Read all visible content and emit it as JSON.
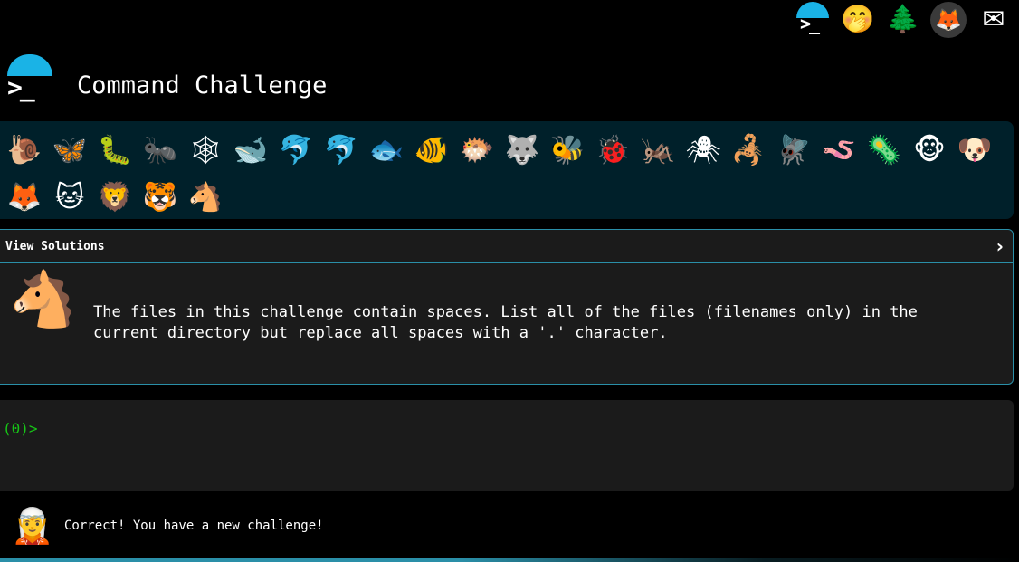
{
  "topbar": {
    "icons": [
      {
        "name": "terminal-logo-icon",
        "glyph": ">_"
      },
      {
        "name": "shushing-face-icon",
        "glyph": "🤭"
      },
      {
        "name": "evergreen-tree-icon",
        "glyph": "🌲"
      },
      {
        "name": "gitlab-icon",
        "glyph": "🦊"
      },
      {
        "name": "envelope-icon",
        "glyph": "✉"
      }
    ]
  },
  "header": {
    "logo_glyph": ">_",
    "title": "Command Challenge"
  },
  "animals": {
    "row1": [
      "🐌",
      "🦋",
      "🐛",
      "🐜",
      "🕸",
      "🐋",
      "🐬",
      "🐬",
      "🐟",
      "🐠",
      "🐡",
      "🐺",
      "🐝",
      "🐞",
      "🦗",
      "🕷",
      "🦂",
      "🪰",
      "🪱",
      "🦠",
      "🐵",
      "🐶"
    ],
    "row2": [
      "🦊",
      "🐱",
      "🦁",
      "🐯",
      "🐴"
    ]
  },
  "solutions": {
    "label": "View Solutions",
    "chevron": "›",
    "avatar_glyph": "🐴",
    "description": "The files in this challenge contain spaces. List all of the files (filenames only) in the current directory but replace all spaces with a '.' character."
  },
  "terminal": {
    "prompt": "(0)>"
  },
  "status": {
    "avatar_glyph": "🧝",
    "message": "Correct! You have a new challenge!"
  },
  "colors": {
    "accent": "#1ab3e6",
    "border": "#2a8fa8",
    "prompt": "#17c517",
    "panel": "#1b1b1b",
    "animal_bar": "#00202a"
  }
}
